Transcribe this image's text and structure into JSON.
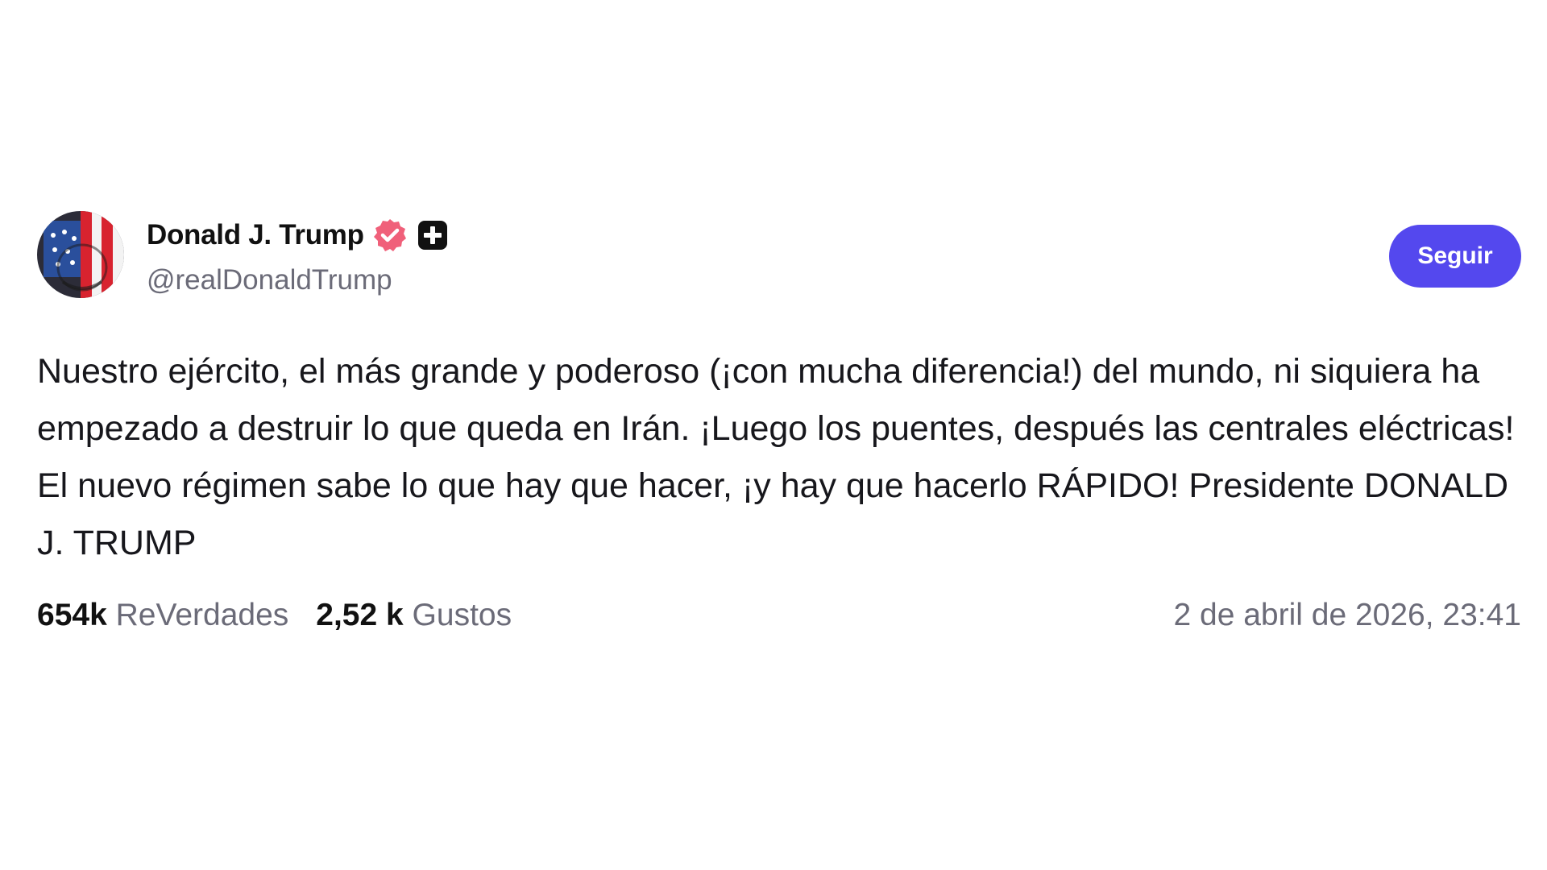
{
  "author": {
    "display_name": "Donald J. Trump",
    "handle": "@realDonaldTrump",
    "verified_color": "#f0607a",
    "badge_icon": "plus-badge-icon"
  },
  "actions": {
    "follow_label": "Seguir",
    "follow_color": "#5448ee"
  },
  "post": {
    "text": "Nuestro ejército, el más grande y poderoso (¡con mucha diferencia!) del mundo, ni siquiera ha empezado a destruir lo que queda en Irán. ¡Luego los puentes, después las centrales eléctricas! El nuevo régimen sabe lo que hay que hacer, ¡y hay que hacerlo RÁPIDO! Presidente DONALD J. TRUMP"
  },
  "stats": {
    "reposts_count": "654k",
    "reposts_label": "ReVerdades",
    "likes_count": "2,52 k",
    "likes_label": "Gustos"
  },
  "timestamp": "2 de abril de 2026, 23:41"
}
